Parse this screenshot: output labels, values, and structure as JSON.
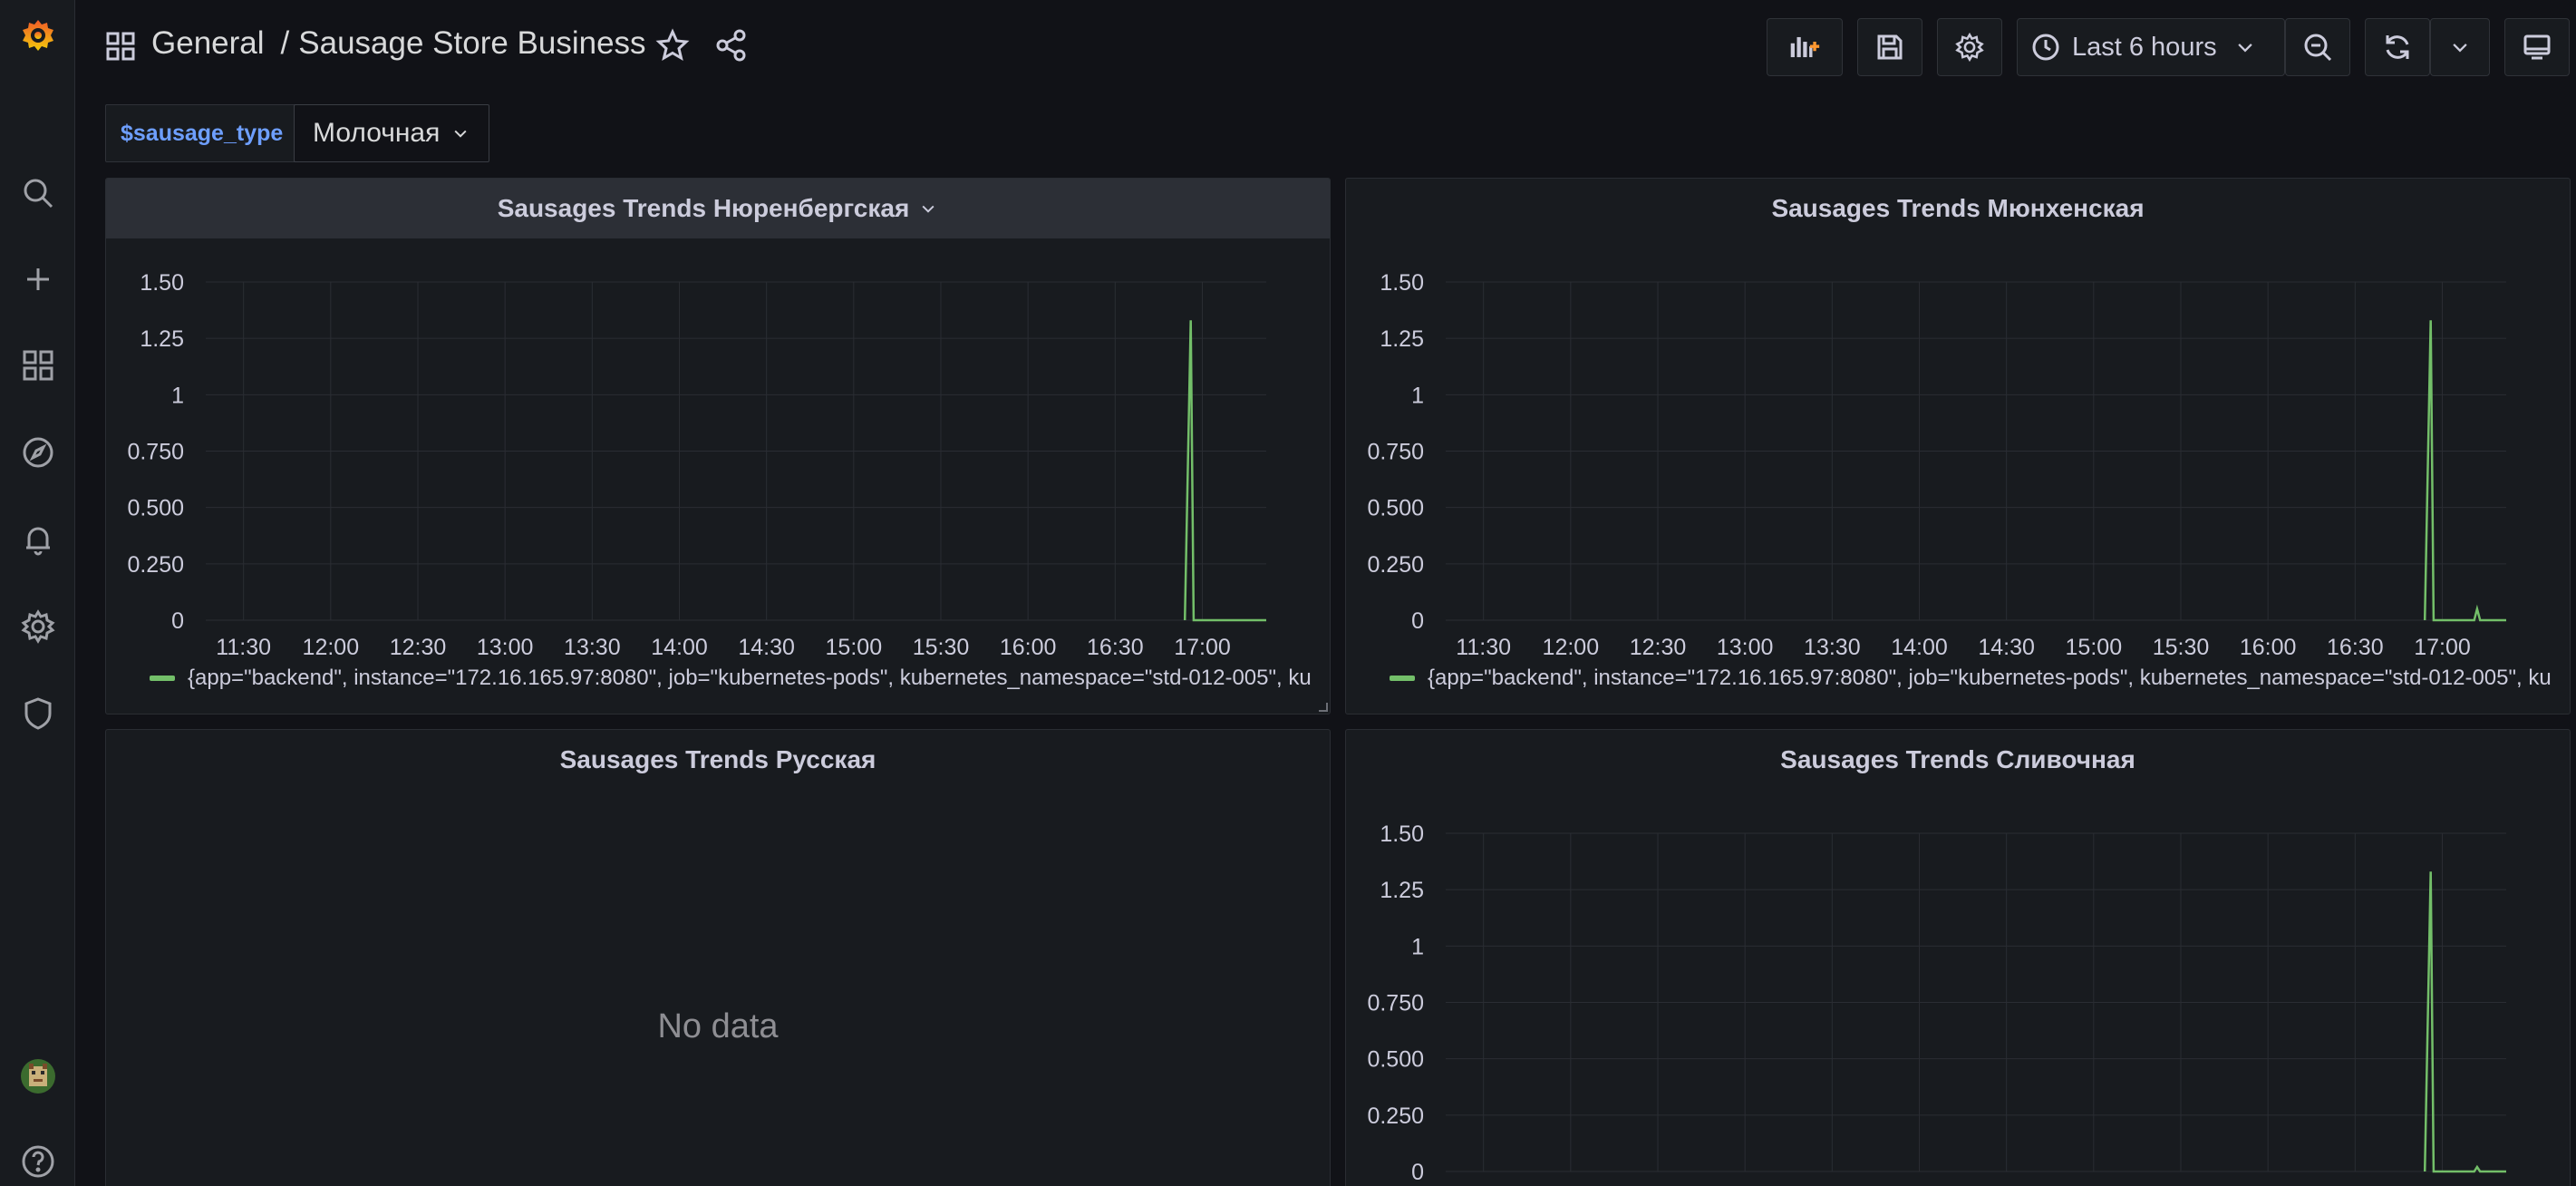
{
  "breadcrumb": {
    "folder": "General",
    "separator": "/",
    "dashboard": "Sausage Store Business"
  },
  "time_picker": {
    "label": "Last 6 hours"
  },
  "variable": {
    "label": "$sausage_type",
    "value": "Молочная"
  },
  "colors": {
    "accent": "#6e9fff",
    "series": "#73bf69",
    "background": "#111217",
    "panel": "#181b1f"
  },
  "icons": {
    "sidebar": [
      "grafana-logo-icon",
      "search-icon",
      "plus-icon",
      "dashboards-icon",
      "explore-icon",
      "alert-bell-icon",
      "gear-icon",
      "shield-icon",
      "user-avatar",
      "help-icon"
    ],
    "toolbar": [
      "add-panel-icon",
      "save-icon",
      "settings-icon",
      "clock-icon",
      "zoom-out-icon",
      "refresh-icon",
      "chevron-down-icon",
      "tv-mode-icon"
    ]
  },
  "panels": [
    {
      "title": "Sausages Trends Нюренбергская",
      "legend": "{app=\"backend\", instance=\"172.16.165.97:8080\", job=\"kubernetes-pods\", kubernetes_namespace=\"std-012-005\", ku",
      "nodata": ""
    },
    {
      "title": "Sausages Trends Мюнхенская",
      "legend": "{app=\"backend\", instance=\"172.16.165.97:8080\", job=\"kubernetes-pods\", kubernetes_namespace=\"std-012-005\", ku",
      "nodata": ""
    },
    {
      "title": "Sausages Trends Русская",
      "legend": "",
      "nodata": "No data"
    },
    {
      "title": "Sausages Trends Сливочная",
      "legend": "",
      "nodata": ""
    }
  ],
  "chart_data": [
    {
      "type": "line",
      "title": "Sausages Trends Нюренбергская",
      "x_ticks": [
        "11:30",
        "12:00",
        "12:30",
        "13:00",
        "13:30",
        "14:00",
        "14:30",
        "15:00",
        "15:30",
        "16:00",
        "16:30",
        "17:00"
      ],
      "y_ticks": [
        "0",
        "0.250",
        "0.500",
        "0.750",
        "1",
        "1.25",
        "1.50"
      ],
      "ylim": [
        0,
        1.5
      ],
      "xlim": [
        "11:17",
        "17:22"
      ],
      "grid": true,
      "series": [
        {
          "points": [
            [
              "16:54",
              0
            ],
            [
              "16:56",
              1.33
            ],
            [
              "16:57",
              0
            ],
            [
              "17:22",
              0
            ]
          ]
        }
      ]
    },
    {
      "type": "line",
      "title": "Sausages Trends Мюнхенская",
      "x_ticks": [
        "11:30",
        "12:00",
        "12:30",
        "13:00",
        "13:30",
        "14:00",
        "14:30",
        "15:00",
        "15:30",
        "16:00",
        "16:30",
        "17:00"
      ],
      "y_ticks": [
        "0",
        "0.250",
        "0.500",
        "0.750",
        "1",
        "1.25",
        "1.50"
      ],
      "ylim": [
        0,
        1.5
      ],
      "xlim": [
        "11:17",
        "17:22"
      ],
      "grid": true,
      "series": [
        {
          "points": [
            [
              "16:54",
              0
            ],
            [
              "16:56",
              1.33
            ],
            [
              "16:57",
              0
            ],
            [
              "17:11",
              0
            ],
            [
              "17:12",
              0.05
            ],
            [
              "17:13",
              0
            ],
            [
              "17:22",
              0
            ]
          ]
        }
      ]
    },
    {
      "type": "line",
      "title": "Sausages Trends Сливочная",
      "y_ticks": [
        "0",
        "0.250",
        "0.500",
        "0.750",
        "1",
        "1.25",
        "1.50"
      ],
      "ylim": [
        0,
        1.5
      ],
      "xlim": [
        "11:17",
        "17:22"
      ],
      "grid": true,
      "series": [
        {
          "points": [
            [
              "16:54",
              0
            ],
            [
              "16:56",
              1.33
            ],
            [
              "16:57",
              0
            ],
            [
              "17:11",
              0
            ],
            [
              "17:12",
              0.02
            ],
            [
              "17:13",
              0
            ],
            [
              "17:22",
              0
            ]
          ]
        }
      ]
    }
  ]
}
